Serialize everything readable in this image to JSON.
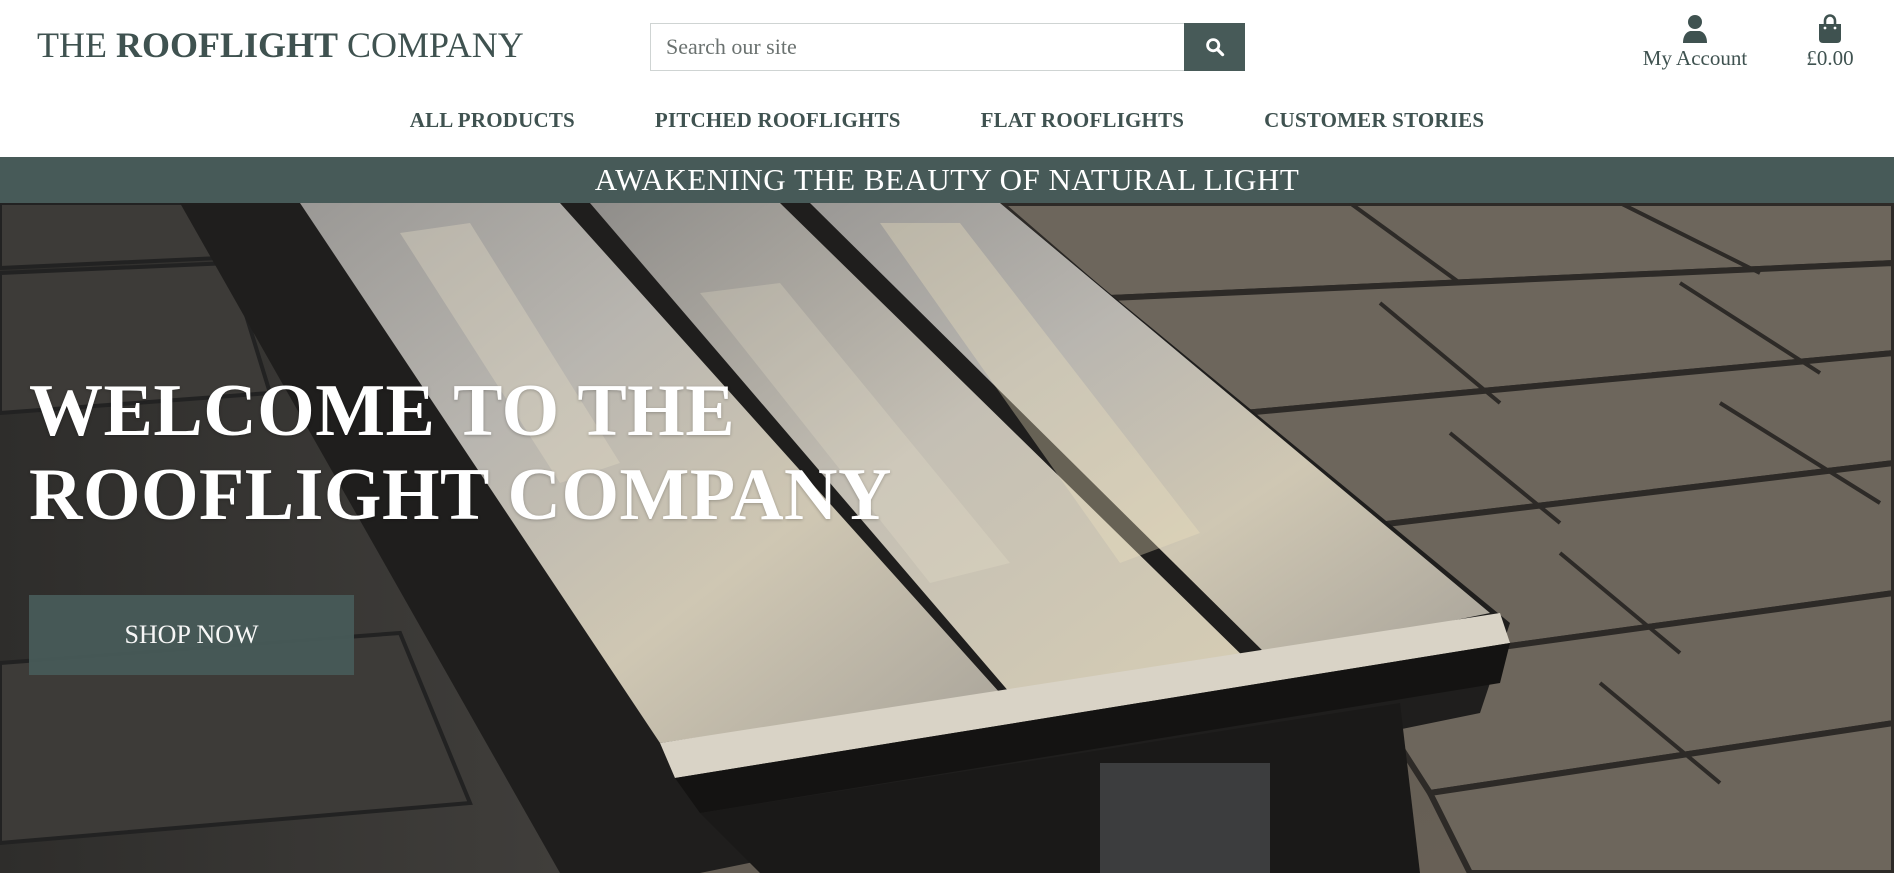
{
  "header": {
    "logo_part1": "THE ",
    "logo_part2": "ROOFLIGHT",
    "logo_part3": " COMPANY",
    "search": {
      "placeholder": "Search our site",
      "value": "",
      "icon": "search-icon"
    },
    "account": {
      "label": "My Account",
      "icon": "user-icon"
    },
    "cart": {
      "label": "£0.00",
      "icon": "shopping-bag-icon"
    }
  },
  "nav": {
    "items": [
      {
        "label": "ALL PRODUCTS"
      },
      {
        "label": "PITCHED ROOFLIGHTS"
      },
      {
        "label": "FLAT ROOFLIGHTS"
      },
      {
        "label": "CUSTOMER STORIES"
      }
    ]
  },
  "banner": {
    "text": "AWAKENING THE BEAUTY OF NATURAL LIGHT"
  },
  "hero": {
    "title_line1": "WELCOME TO THE",
    "title_line2": "ROOFLIGHT COMPANY",
    "cta_label": "SHOP NOW"
  },
  "colors": {
    "brand": "#475a58",
    "text": "#3f5250",
    "white": "#ffffff"
  }
}
